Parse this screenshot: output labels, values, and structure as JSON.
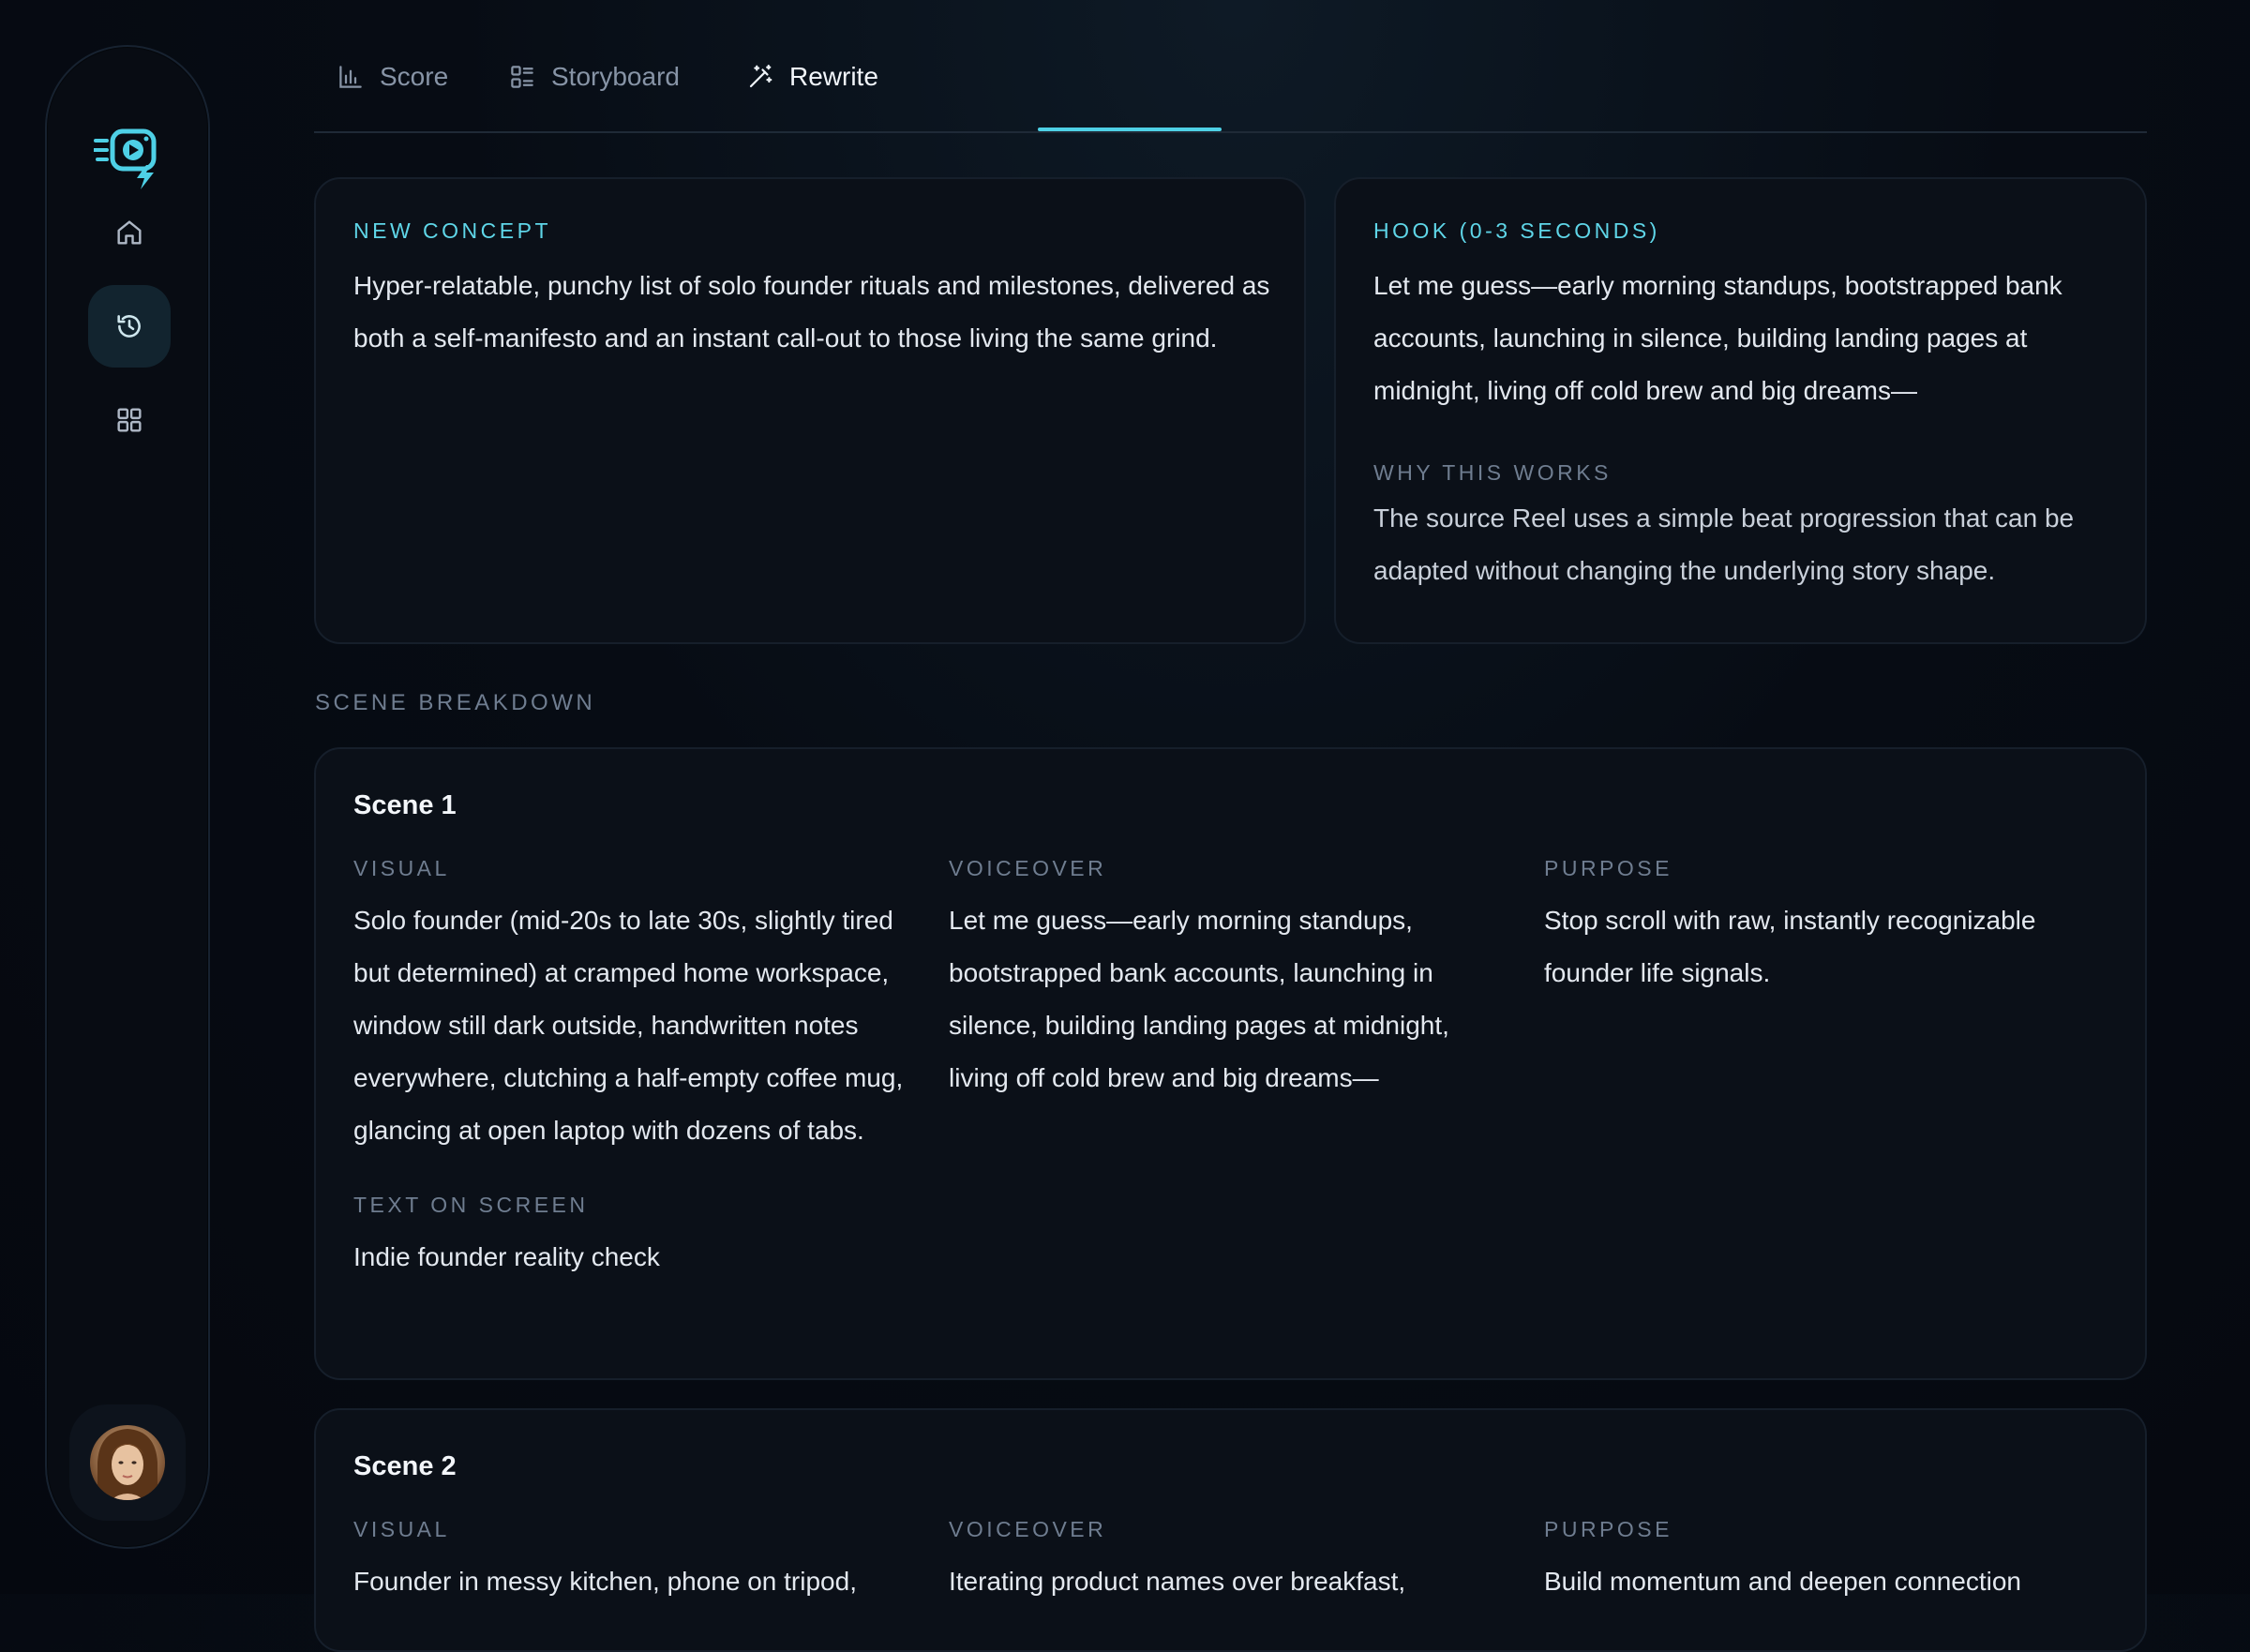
{
  "tabs": [
    {
      "label": "Score",
      "icon": "bar-chart-icon"
    },
    {
      "label": "Storyboard",
      "icon": "storyboard-list-icon"
    },
    {
      "label": "Rewrite",
      "icon": "magic-wand-icon",
      "active": true
    }
  ],
  "sidebar": {
    "items": [
      {
        "name": "home",
        "icon": "home-icon"
      },
      {
        "name": "history",
        "icon": "history-icon",
        "active": true
      },
      {
        "name": "apps",
        "icon": "grid-icon"
      }
    ],
    "accent": "#4ed0e6"
  },
  "concept": {
    "label": "NEW CONCEPT",
    "text": "Hyper-relatable, punchy list of solo founder rituals and milestones, delivered as both a self-manifesto and an instant call-out to those living the same grind."
  },
  "hook": {
    "label": "HOOK (0-3 SECONDS)",
    "text": "Let me guess—early morning standups, bootstrapped bank accounts, launching in silence, building landing pages at midnight, living off cold brew and big dreams—",
    "why_label": "WHY THIS WORKS",
    "why_text": "The source Reel uses a simple beat progression that can be adapted without changing the underlying story shape."
  },
  "breakdown": {
    "title": "SCENE BREAKDOWN",
    "col_labels": {
      "visual": "VISUAL",
      "voiceover": "VOICEOVER",
      "purpose": "PURPOSE",
      "text_on_screen": "TEXT ON SCREEN"
    },
    "scenes": [
      {
        "title": "Scene 1",
        "visual": "Solo founder (mid-20s to late 30s, slightly tired but determined) at cramped home workspace, window still dark outside, handwritten notes everywhere, clutching a half-empty coffee mug, glancing at open laptop with dozens of tabs.",
        "voiceover": "Let me guess—early morning standups, bootstrapped bank accounts, launching in silence, building landing pages at midnight, living off cold brew and big dreams—",
        "purpose": "Stop scroll with raw, instantly recognizable founder life signals.",
        "text_on_screen": "Indie founder reality check"
      },
      {
        "title": "Scene 2",
        "visual": "Founder in messy kitchen, phone on tripod,",
        "voiceover": "Iterating product names over breakfast,",
        "purpose": "Build momentum and deepen connection"
      }
    ]
  }
}
